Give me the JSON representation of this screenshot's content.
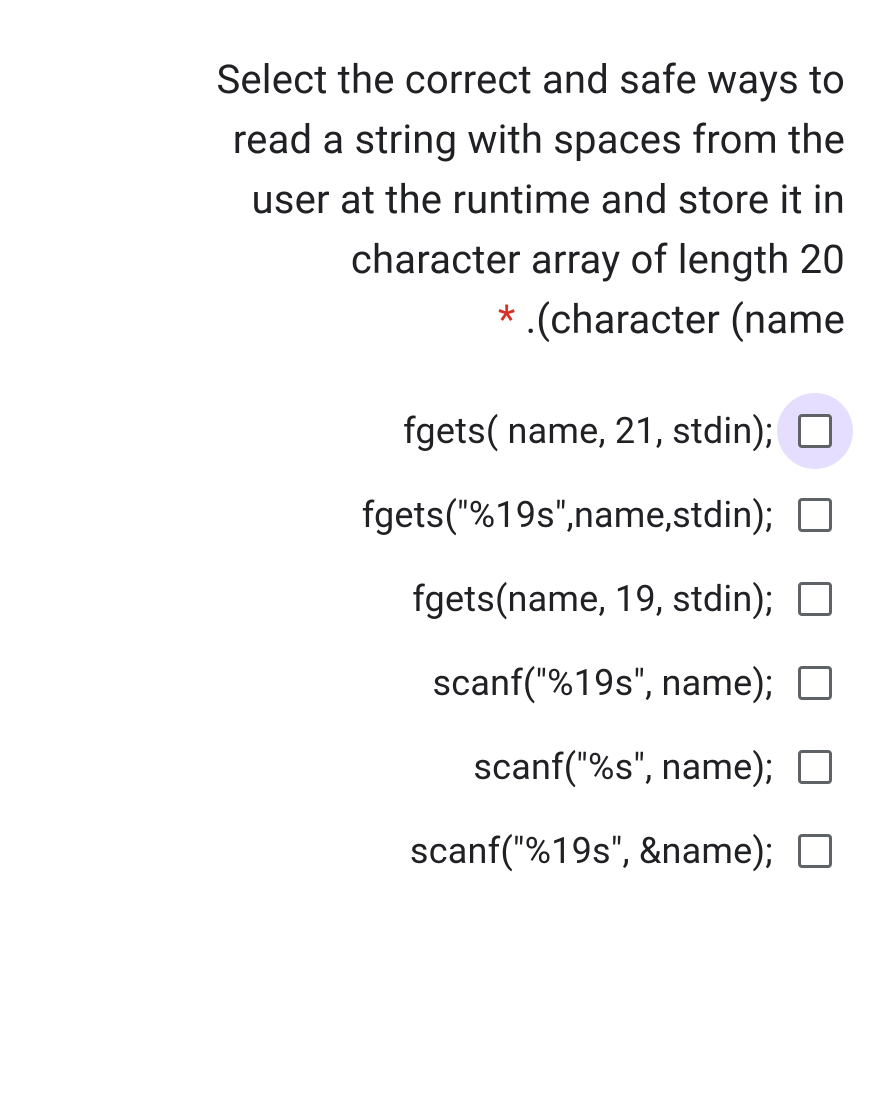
{
  "question": {
    "line1": "Select the correct and safe ways to",
    "line2": "read a string with spaces from the",
    "line3": "user at the runtime and store it in",
    "line4": "character array of length 20",
    "line5_suffix": ".(character (name",
    "required_mark": "*"
  },
  "options": [
    {
      "label": "fgets( name, 21, stdin);",
      "highlighted": true
    },
    {
      "label": "fgets(\"%19s\",name,stdin);",
      "highlighted": false
    },
    {
      "label": "fgets(name, 19, stdin);",
      "highlighted": false
    },
    {
      "label": "scanf(\"%19s\", name);",
      "highlighted": false
    },
    {
      "label": "scanf(\"%s\", name);",
      "highlighted": false
    },
    {
      "label": "scanf(\"%19s\", &name);",
      "highlighted": false
    }
  ]
}
